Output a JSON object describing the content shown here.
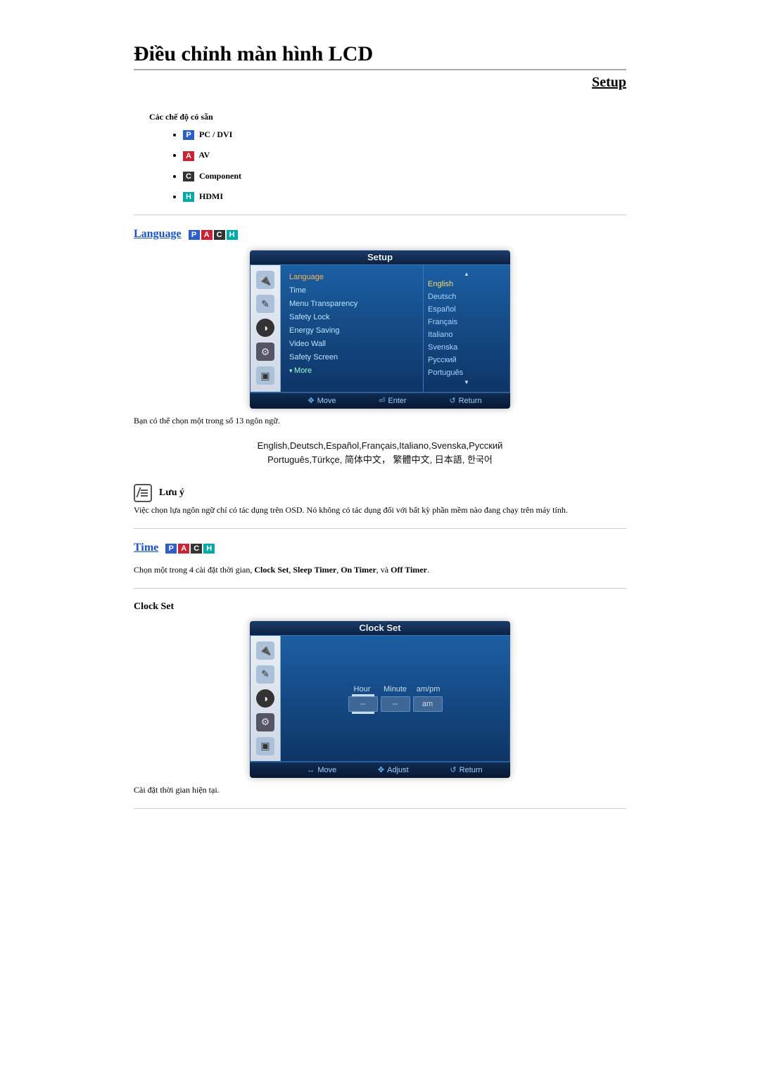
{
  "page_title": "Điều chỉnh màn hình LCD",
  "setup_heading": "Setup",
  "modes_heading": "Các chế độ có sẵn",
  "modes": {
    "p": {
      "letter": "P",
      "label": "PC / DVI"
    },
    "a": {
      "letter": "A",
      "label": "AV"
    },
    "c": {
      "letter": "C",
      "label": "Component"
    },
    "h": {
      "letter": "H",
      "label": "HDMI"
    }
  },
  "language_section": {
    "title": "Language",
    "osd": {
      "title": "Setup",
      "menu": [
        "Language",
        "Time",
        "Menu Transparency",
        "Safety Lock",
        "Energy Saving",
        "Video Wall",
        "Safety Screen"
      ],
      "more": "More",
      "options": [
        "English",
        "Deutsch",
        "Español",
        "Français",
        "Italiano",
        "Svenska",
        "Русский",
        "Português"
      ],
      "footer": {
        "move": "Move",
        "enter": "Enter",
        "return": "Return"
      }
    },
    "desc": "Bạn có thể chọn một trong số 13 ngôn ngữ.",
    "lang_line1": "English,Deutsch,Español,Français,Italiano,Svenska,Русский",
    "lang_line2": "Português,Türkçe, 简体中文， 繁體中文, 日本語, 한국어",
    "note_label": "Lưu ý",
    "note_text": "Việc chọn lựa ngôn ngữ chỉ có tác dụng trên OSD. Nó không có tác dụng đối với bất kỳ phần mềm nào đang chạy trên máy tính."
  },
  "time_section": {
    "title": "Time",
    "desc_pre": "Chọn một trong 4 cài đặt thời gian, ",
    "desc_b1": "Clock Set",
    "desc_b2": "Sleep Timer",
    "desc_b3": "On Timer",
    "desc_mid": ", và ",
    "desc_b4": "Off Timer",
    "desc_end": ".",
    "clock_set_heading": "Clock Set",
    "osd": {
      "title": "Clock Set",
      "labels": {
        "hour": "Hour",
        "minute": "Minute",
        "ampm": "am/pm"
      },
      "values": {
        "hour": "--",
        "minute": "--",
        "ampm": "am"
      },
      "footer": {
        "move": "Move",
        "adjust": "Adjust",
        "return": "Return"
      }
    },
    "desc_after": "Cài đặt thời gian hiện tại."
  }
}
